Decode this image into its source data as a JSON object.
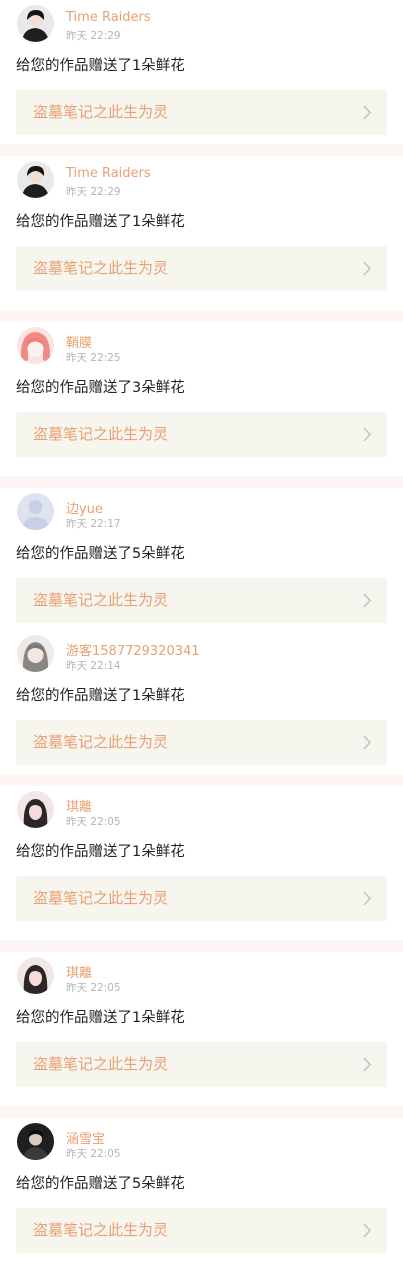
{
  "notifications": [
    {
      "user": "Time Raiders",
      "time": "昨天 22:29",
      "message": "给您的作品赠送了1朵鲜花",
      "work_title": "盗墓笔记之此生为灵",
      "avatar_icon": "avatar-dark-figure-icon",
      "accent": "#e9a070"
    },
    {
      "user": "Time Raiders",
      "time": "昨天 22:29",
      "message": "给您的作品赠送了1朵鲜花",
      "work_title": "盗墓笔记之此生为灵",
      "avatar_icon": "avatar-dark-figure-icon",
      "accent": "#e9a070"
    },
    {
      "user": "鞘膜",
      "time": "昨天 22:25",
      "message": "给您的作品赠送了3朵鲜花",
      "work_title": "盗墓笔记之此生为灵",
      "avatar_icon": "avatar-pink-hair-icon",
      "accent": "#e9a070"
    },
    {
      "user": "边yue",
      "time": "昨天 22:17",
      "message": "给您的作品赠送了5朵鲜花",
      "work_title": "盗墓笔记之此生为灵",
      "avatar_icon": "avatar-default-icon",
      "accent": "#e9a070"
    },
    {
      "user": "游客1587729320341",
      "time": "昨天 22:14",
      "message": "给您的作品赠送了1朵鲜花",
      "work_title": "盗墓笔记之此生为灵",
      "avatar_icon": "avatar-anime-girl-icon",
      "accent": "#e9a070"
    },
    {
      "user": "琪離",
      "time": "昨天 22:05",
      "message": "给您的作品赠送了1朵鲜花",
      "work_title": "盗墓笔记之此生为灵",
      "avatar_icon": "avatar-dark-hair-icon",
      "accent": "#e9a070"
    },
    {
      "user": "琪離",
      "time": "昨天 22:05",
      "message": "给您的作品赠送了1朵鲜花",
      "work_title": "盗墓笔记之此生为灵",
      "avatar_icon": "avatar-dark-hair-icon",
      "accent": "#e9a070"
    },
    {
      "user": "涵雪宝",
      "time": "昨天 22:05",
      "message": "给您的作品赠送了5朵鲜花",
      "work_title": "盗墓笔记之此生为灵",
      "avatar_icon": "avatar-dark-figure-icon",
      "accent": "#e9a070"
    }
  ]
}
